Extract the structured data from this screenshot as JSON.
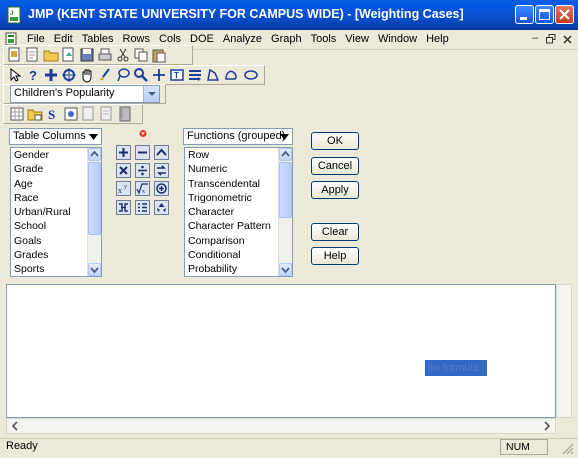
{
  "window": {
    "title": "JMP (KENT STATE UNIVERSITY FOR CAMPUS WIDE)  - [Weighting Cases]"
  },
  "menubar": {
    "items": [
      "File",
      "Edit",
      "Tables",
      "Rows",
      "Cols",
      "DOE",
      "Analyze",
      "Graph",
      "Tools",
      "View",
      "Window",
      "Help"
    ]
  },
  "toolbar": {
    "table_combo_value": "Children's Popularity"
  },
  "formula_dialog": {
    "columns_combo": "Table Columns",
    "columns": [
      "Gender",
      "Grade",
      "Age",
      "Race",
      "Urban/Rural",
      "School",
      "Goals",
      "Grades",
      "Sports"
    ],
    "functions_combo": "Functions (grouped)",
    "functions": [
      "Row",
      "Numeric",
      "Transcendental",
      "Trigonometric",
      "Character",
      "Character Pattern",
      "Comparison",
      "Conditional",
      "Probability"
    ],
    "buttons": {
      "ok": "OK",
      "cancel": "Cancel",
      "apply": "Apply",
      "clear": "Clear",
      "help": "Help"
    },
    "formula_placeholder": "no formula"
  },
  "status": {
    "text": "Ready",
    "num": "NUM"
  },
  "colors": {
    "titlebar": "#0a4fd1",
    "selection": "#316ac5"
  }
}
